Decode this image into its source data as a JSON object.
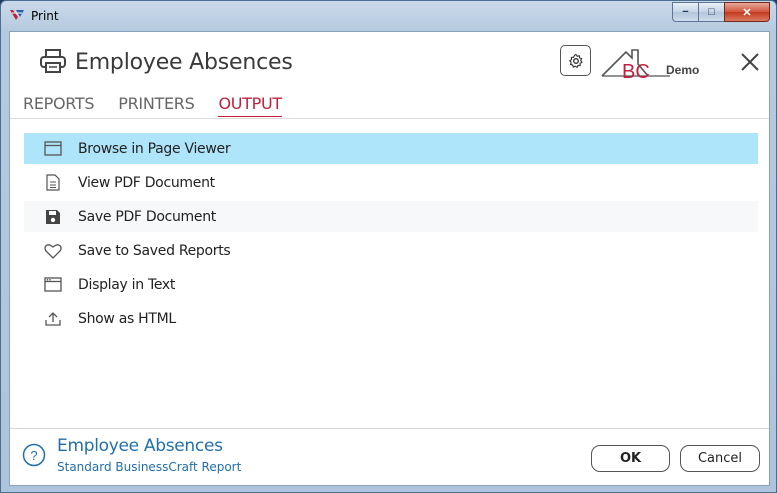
{
  "window": {
    "title": "Print",
    "controls": {
      "minimize": "−",
      "maximize": "□",
      "close": "✕"
    }
  },
  "header": {
    "title": "Employee Absences",
    "logo_letters": "BC",
    "logo_sub": "Demo"
  },
  "tabs": [
    {
      "label": "REPORTS",
      "active": false
    },
    {
      "label": "PRINTERS",
      "active": false
    },
    {
      "label": "OUTPUT",
      "active": true
    }
  ],
  "outputs": [
    {
      "label": "Browse in Page Viewer",
      "icon": "window-icon",
      "selected": true
    },
    {
      "label": "View PDF Document",
      "icon": "document-icon",
      "selected": false
    },
    {
      "label": "Save PDF Document",
      "icon": "floppy-disk-icon",
      "selected": false
    },
    {
      "label": "Save to Saved Reports",
      "icon": "heart-icon",
      "selected": false
    },
    {
      "label": "Display in Text",
      "icon": "text-window-icon",
      "selected": false
    },
    {
      "label": "Show as HTML",
      "icon": "export-tray-icon",
      "selected": false
    }
  ],
  "footer": {
    "title": "Employee Absences",
    "subtitle": "Standard BusinessCraft Report",
    "ok_label": "OK",
    "cancel_label": "Cancel"
  },
  "colors": {
    "accent": "#c0213c",
    "selected_row": "#aee5fa",
    "footer_text": "#1f6fad"
  }
}
